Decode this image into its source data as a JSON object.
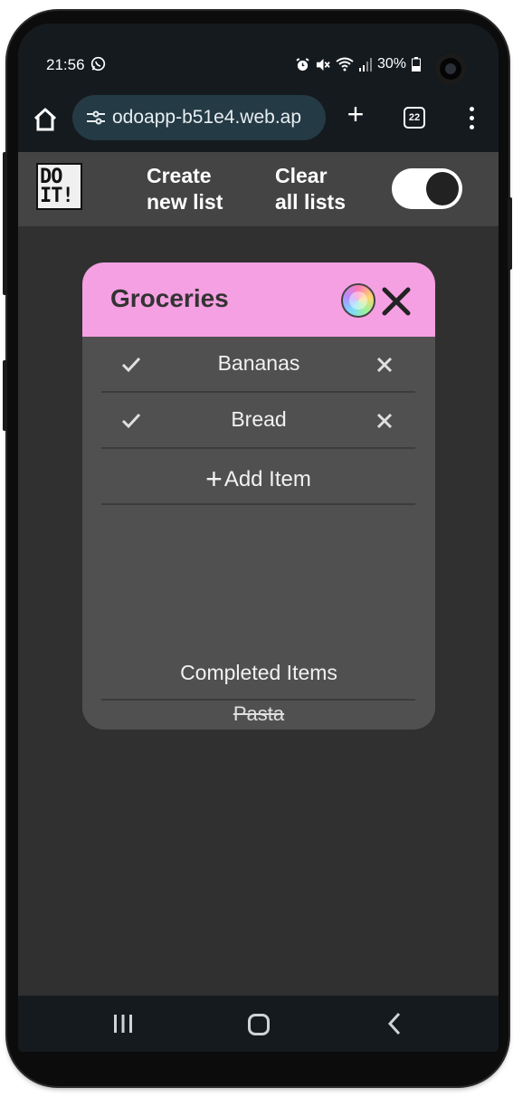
{
  "status_bar": {
    "time": "21:56",
    "battery": "30%",
    "icons": [
      "whatsapp-icon",
      "alarm-icon",
      "mute-icon",
      "wifi-icon",
      "signal-icon",
      "battery-icon"
    ]
  },
  "browser": {
    "url": "odoapp-b51e4.web.ap",
    "tab_count": "22",
    "new_tab_label": "+"
  },
  "header": {
    "logo_line1": "DO",
    "logo_line2": "IT!",
    "create_line1": "Create",
    "create_line2": "new list",
    "clear_line1": "Clear",
    "clear_line2": "all lists",
    "dark_mode_on": true
  },
  "list": {
    "title": "Groceries",
    "header_color": "#f5a0e2",
    "items": [
      {
        "text": "Bananas"
      },
      {
        "text": "Bread"
      }
    ],
    "add_item_label": "Add Item",
    "add_item_plus": "+",
    "completed_label": "Completed Items",
    "completed_items": [
      {
        "text": "Pasta"
      }
    ]
  },
  "colors": {
    "page_bg": "#303030",
    "header_bg": "#444444",
    "card_bg": "#505050",
    "card_head": "#f5a0e2",
    "system_bar": "#151a1f"
  }
}
